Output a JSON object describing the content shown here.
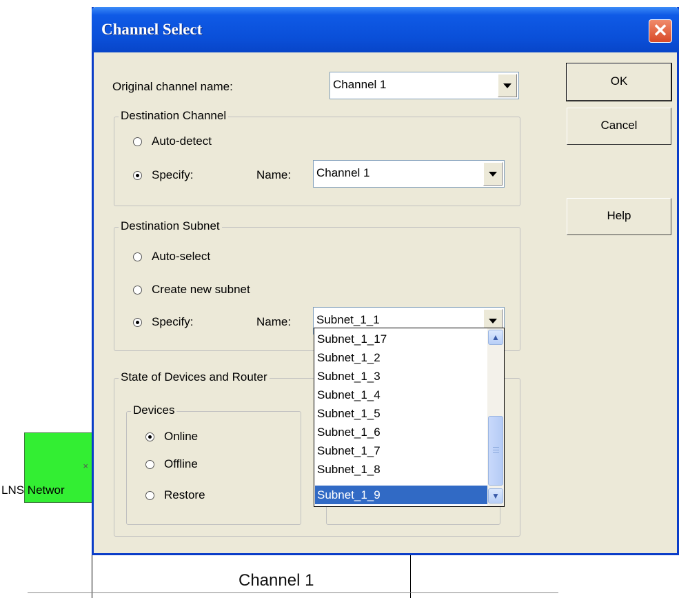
{
  "background": {
    "node_label": "LNS Networ",
    "channel_label": "Channel 1",
    "node_color": "#33ee33"
  },
  "dialog": {
    "title": "Channel Select",
    "close_label": "✕",
    "original_channel": {
      "label": "Original channel name:",
      "value": "Channel 1"
    },
    "destination_channel": {
      "legend": "Destination Channel",
      "auto_detect": "Auto-detect",
      "specify": "Specify:",
      "name_label": "Name:",
      "name_value": "Channel 1",
      "selected": "specify"
    },
    "destination_subnet": {
      "legend": "Destination Subnet",
      "auto_select": "Auto-select",
      "create_new": "Create new subnet",
      "specify": "Specify:",
      "name_label": "Name:",
      "name_value": "Subnet_1_1",
      "selected": "specify"
    },
    "state_group": {
      "legend": "State of Devices and Router",
      "devices": {
        "legend": "Devices",
        "online": "Online",
        "offline": "Offline",
        "restore": "Restore",
        "selected": "online"
      }
    },
    "buttons": {
      "ok": "OK",
      "cancel": "Cancel",
      "help": "Help"
    },
    "subnet_dropdown": {
      "options": [
        "Subnet_1_17",
        "Subnet_1_2",
        "Subnet_1_3",
        "Subnet_1_4",
        "Subnet_1_5",
        "Subnet_1_6",
        "Subnet_1_7",
        "Subnet_1_8",
        "Subnet_1_9"
      ],
      "highlighted": "Subnet_1_9"
    }
  },
  "colors": {
    "titlebar": "#0a4fd8",
    "selection": "#316ac5",
    "dialog_bg": "#ece9d8"
  }
}
